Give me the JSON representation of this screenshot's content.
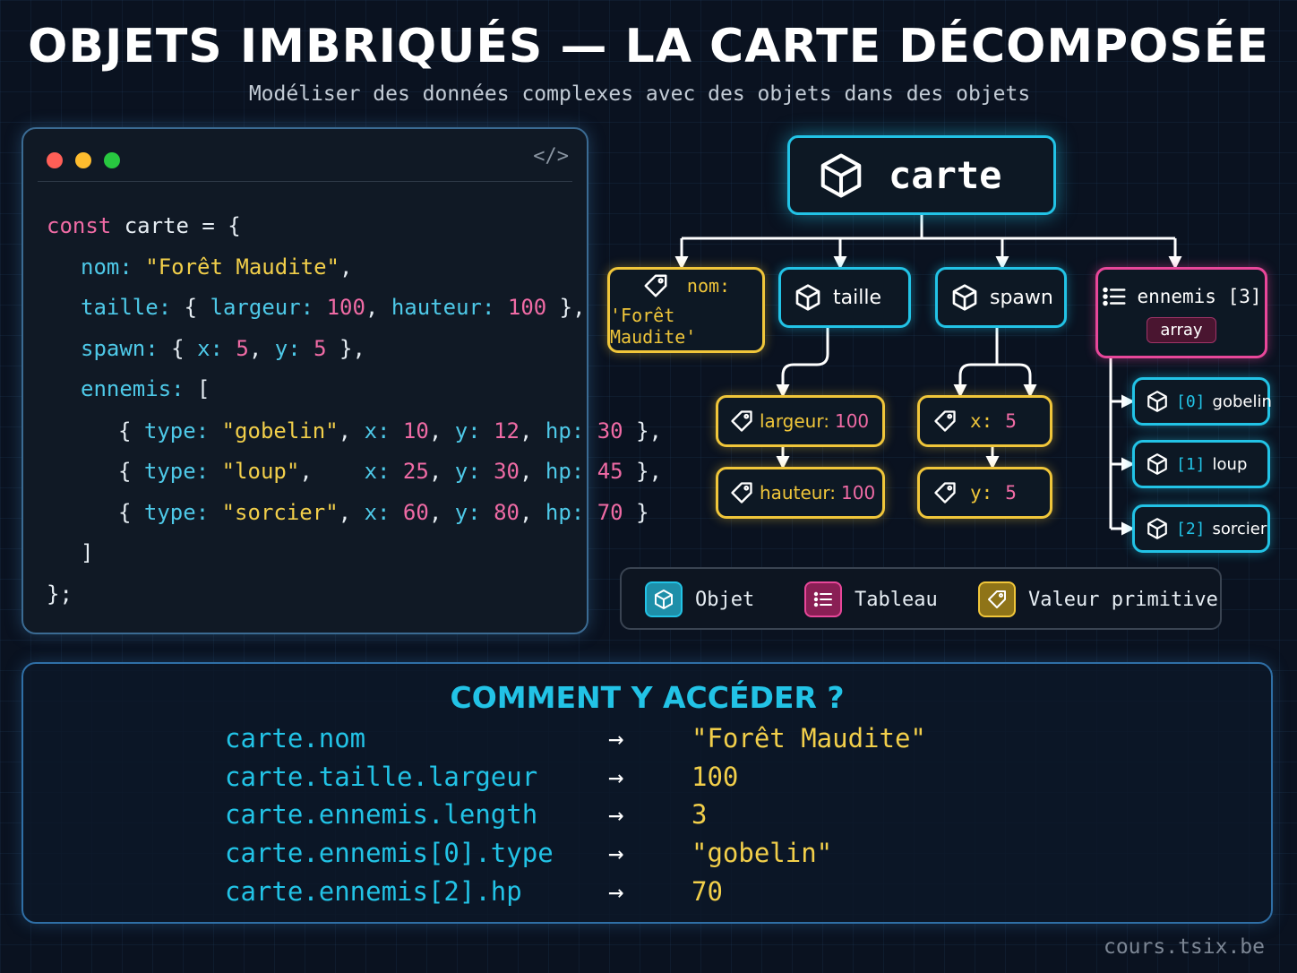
{
  "header": {
    "title": "OBJETS IMBRIQUÉS — LA CARTE DÉCOMPOSÉE",
    "subtitle": "Modéliser des données complexes avec des objets dans des objets"
  },
  "code_panel": {
    "window_dots": [
      "#ff5f57",
      "#febc2e",
      "#28c840"
    ],
    "code_icon": "</>",
    "lines": [
      [
        [
          "k",
          "const"
        ],
        [
          "w",
          " carte = {"
        ]
      ],
      [
        [
          "p",
          "nom:"
        ],
        [
          "w",
          " "
        ],
        [
          "s",
          "\"Forêt Maudite\""
        ],
        [
          "w",
          ","
        ]
      ],
      [
        [
          "p",
          "taille:"
        ],
        [
          "w",
          " { "
        ],
        [
          "p",
          "largeur:"
        ],
        [
          "w",
          " "
        ],
        [
          "n",
          "100"
        ],
        [
          "w",
          ", "
        ],
        [
          "p",
          "hauteur:"
        ],
        [
          "w",
          " "
        ],
        [
          "n",
          "100"
        ],
        [
          "w",
          " },"
        ]
      ],
      [
        [
          "p",
          "spawn:"
        ],
        [
          "w",
          " { "
        ],
        [
          "p",
          "x:"
        ],
        [
          "w",
          " "
        ],
        [
          "n",
          "5"
        ],
        [
          "w",
          ", "
        ],
        [
          "p",
          "y:"
        ],
        [
          "w",
          " "
        ],
        [
          "n",
          "5"
        ],
        [
          "w",
          " },"
        ]
      ],
      [
        [
          "p",
          "ennemis:"
        ],
        [
          "w",
          " ["
        ]
      ],
      [
        [
          "w",
          "{ "
        ],
        [
          "p",
          "type:"
        ],
        [
          "w",
          " "
        ],
        [
          "s",
          "\"gobelin\""
        ],
        [
          "w",
          ", "
        ],
        [
          "p",
          "x:"
        ],
        [
          "w",
          " "
        ],
        [
          "n",
          "10"
        ],
        [
          "w",
          ", "
        ],
        [
          "p",
          "y:"
        ],
        [
          "w",
          " "
        ],
        [
          "n",
          "12"
        ],
        [
          "w",
          ", "
        ],
        [
          "p",
          "hp:"
        ],
        [
          "w",
          " "
        ],
        [
          "n",
          "30"
        ],
        [
          "w",
          " },"
        ]
      ],
      [
        [
          "w",
          "{ "
        ],
        [
          "p",
          "type:"
        ],
        [
          "w",
          " "
        ],
        [
          "s",
          "\"loup\""
        ],
        [
          "w",
          ",    "
        ],
        [
          "p",
          "x:"
        ],
        [
          "w",
          " "
        ],
        [
          "n",
          "25"
        ],
        [
          "w",
          ", "
        ],
        [
          "p",
          "y:"
        ],
        [
          "w",
          " "
        ],
        [
          "n",
          "30"
        ],
        [
          "w",
          ", "
        ],
        [
          "p",
          "hp:"
        ],
        [
          "w",
          " "
        ],
        [
          "n",
          "45"
        ],
        [
          "w",
          " },"
        ]
      ],
      [
        [
          "w",
          "{ "
        ],
        [
          "p",
          "type:"
        ],
        [
          "w",
          " "
        ],
        [
          "s",
          "\"sorcier\""
        ],
        [
          "w",
          ", "
        ],
        [
          "p",
          "x:"
        ],
        [
          "w",
          " "
        ],
        [
          "n",
          "60"
        ],
        [
          "w",
          ", "
        ],
        [
          "p",
          "y:"
        ],
        [
          "w",
          " "
        ],
        [
          "n",
          "80"
        ],
        [
          "w",
          ", "
        ],
        [
          "p",
          "hp:"
        ],
        [
          "w",
          " "
        ],
        [
          "n",
          "70"
        ],
        [
          "w",
          " }"
        ]
      ],
      [
        [
          "w",
          "]"
        ]
      ],
      [
        [
          "w",
          "};"
        ]
      ]
    ]
  },
  "diagram": {
    "root": {
      "label": "carte",
      "icon": "cube-icon"
    },
    "nom": {
      "key": "nom:",
      "value": "'Forêt Maudite'",
      "icon": "tag-icon"
    },
    "taille": {
      "label": "taille",
      "icon": "cube-icon"
    },
    "spawn": {
      "label": "spawn",
      "icon": "cube-icon"
    },
    "ennemis": {
      "label": "ennemis [3]",
      "badge": "array",
      "icon": "list-icon"
    },
    "largeur": {
      "key": "largeur:",
      "value": "100"
    },
    "hauteur": {
      "key": "hauteur:",
      "value": "100"
    },
    "x": {
      "key": "x:",
      "value": "5"
    },
    "y": {
      "key": "y:",
      "value": "5"
    },
    "enemy0": {
      "index": "[0]",
      "name": "gobelin"
    },
    "enemy1": {
      "index": "[1]",
      "name": "loup"
    },
    "enemy2": {
      "index": "[2]",
      "name": "sorcier"
    }
  },
  "legend": {
    "objet": "Objet",
    "tableau": "Tableau",
    "primitive": "Valeur primitive"
  },
  "access": {
    "title": "COMMENT Y ACCÉDER ?",
    "arrow": "→",
    "rows": [
      {
        "expr": "carte.nom",
        "value": "\"Forêt Maudite\""
      },
      {
        "expr": "carte.taille.largeur",
        "value": "100"
      },
      {
        "expr": "carte.ennemis.length",
        "value": "3"
      },
      {
        "expr": "carte.ennemis[0].type",
        "value": "\"gobelin\""
      },
      {
        "expr": "carte.ennemis[2].hp",
        "value": "70"
      }
    ]
  },
  "footer": "cours.tsix.be",
  "colors": {
    "object": "#22c3e6",
    "array": "#e8479a",
    "primitive": "#f0c63a",
    "keyword": "#f06ba5",
    "string": "#f2cf4a"
  }
}
